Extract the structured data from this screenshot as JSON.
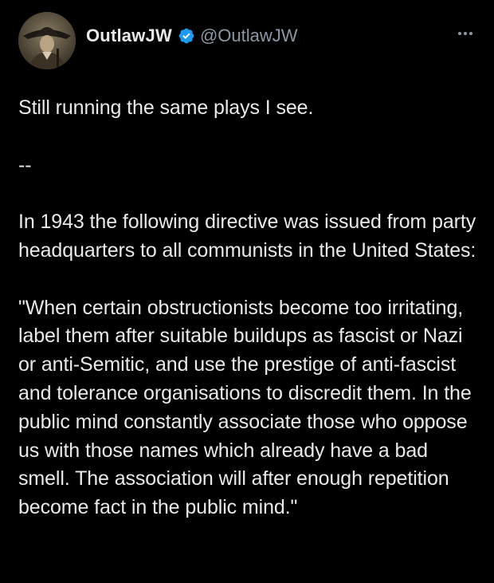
{
  "user": {
    "display_name": "OutlawJW",
    "handle": "@OutlawJW",
    "verified": true
  },
  "colors": {
    "background": "#000000",
    "text": "#e7e9ea",
    "secondary_text": "#8b98a5",
    "verified_badge": "#1d9bf0"
  },
  "icons": {
    "verified": "verified-badge-icon",
    "more": "more-horizontal-icon"
  },
  "tweet": {
    "line1": "Still running the same plays I see.",
    "separator": "--",
    "intro": "In 1943 the following directive was issued from party headquarters to all communists in the United States:",
    "quote": "\"When certain obstructionists become too irritating, label them after suitable buildups as fascist or Nazi or anti-Semitic, and use the prestige of anti-fascist and tolerance organisations to discredit them. In the public mind constantly associate those who oppose us with those names which already have a bad smell. The association will after enough repetition become fact in the public mind.\""
  }
}
